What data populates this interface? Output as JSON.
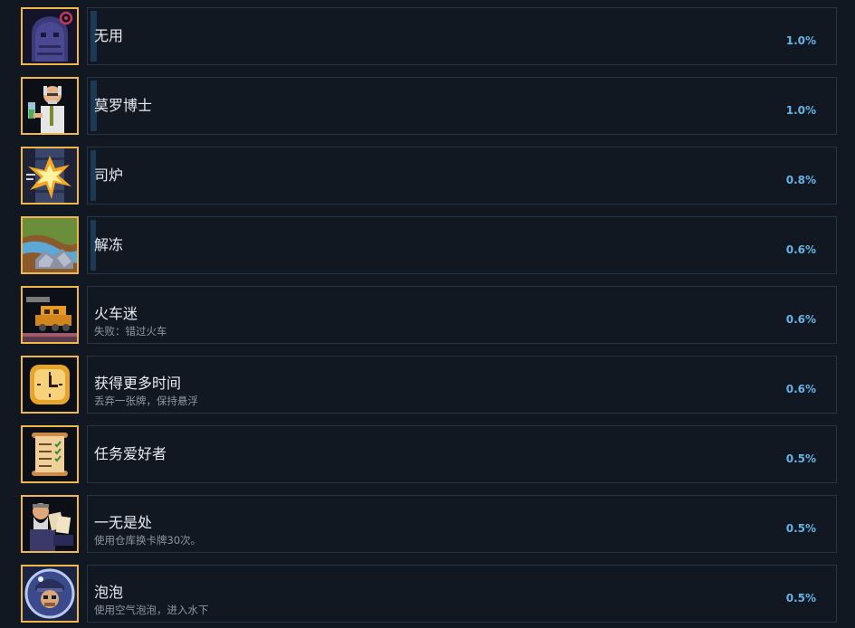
{
  "achievements": [
    {
      "icon": "shadow-creature-icon",
      "title": "无用",
      "desc": "",
      "percent": "1.0%",
      "fraction": 0.01
    },
    {
      "icon": "doctor-portrait-icon",
      "title": "莫罗博士",
      "desc": "",
      "percent": "1.0%",
      "fraction": 0.01
    },
    {
      "icon": "explosion-icon",
      "title": "司炉",
      "desc": "",
      "percent": "0.8%",
      "fraction": 0.008
    },
    {
      "icon": "frozen-landscape-icon",
      "title": "解冻",
      "desc": "",
      "percent": "0.6%",
      "fraction": 0.006
    },
    {
      "icon": "train-icon",
      "title": "火车迷",
      "desc": "失败：错过火车",
      "percent": "0.6%",
      "fraction": 0.006
    },
    {
      "icon": "clock-icon",
      "title": "获得更多时间",
      "desc": "丢弃一张牌，保持悬浮",
      "percent": "0.6%",
      "fraction": 0.006
    },
    {
      "icon": "scroll-checklist-icon",
      "title": "任务爱好者",
      "desc": "",
      "percent": "0.5%",
      "fraction": 0.005
    },
    {
      "icon": "old-man-cards-icon",
      "title": "一无是处",
      "desc": "使用仓库换卡牌30次。",
      "percent": "0.5%",
      "fraction": 0.005
    },
    {
      "icon": "bubble-diver-icon",
      "title": "泡泡",
      "desc": "使用空气泡泡，进入水下",
      "percent": "0.5%",
      "fraction": 0.005
    }
  ],
  "colors": {
    "background": "#111821",
    "panel_border": "#253545",
    "progress_fill": "#1c3a55",
    "percent_text": "#66b3e5",
    "icon_border": "#f2b74a"
  }
}
